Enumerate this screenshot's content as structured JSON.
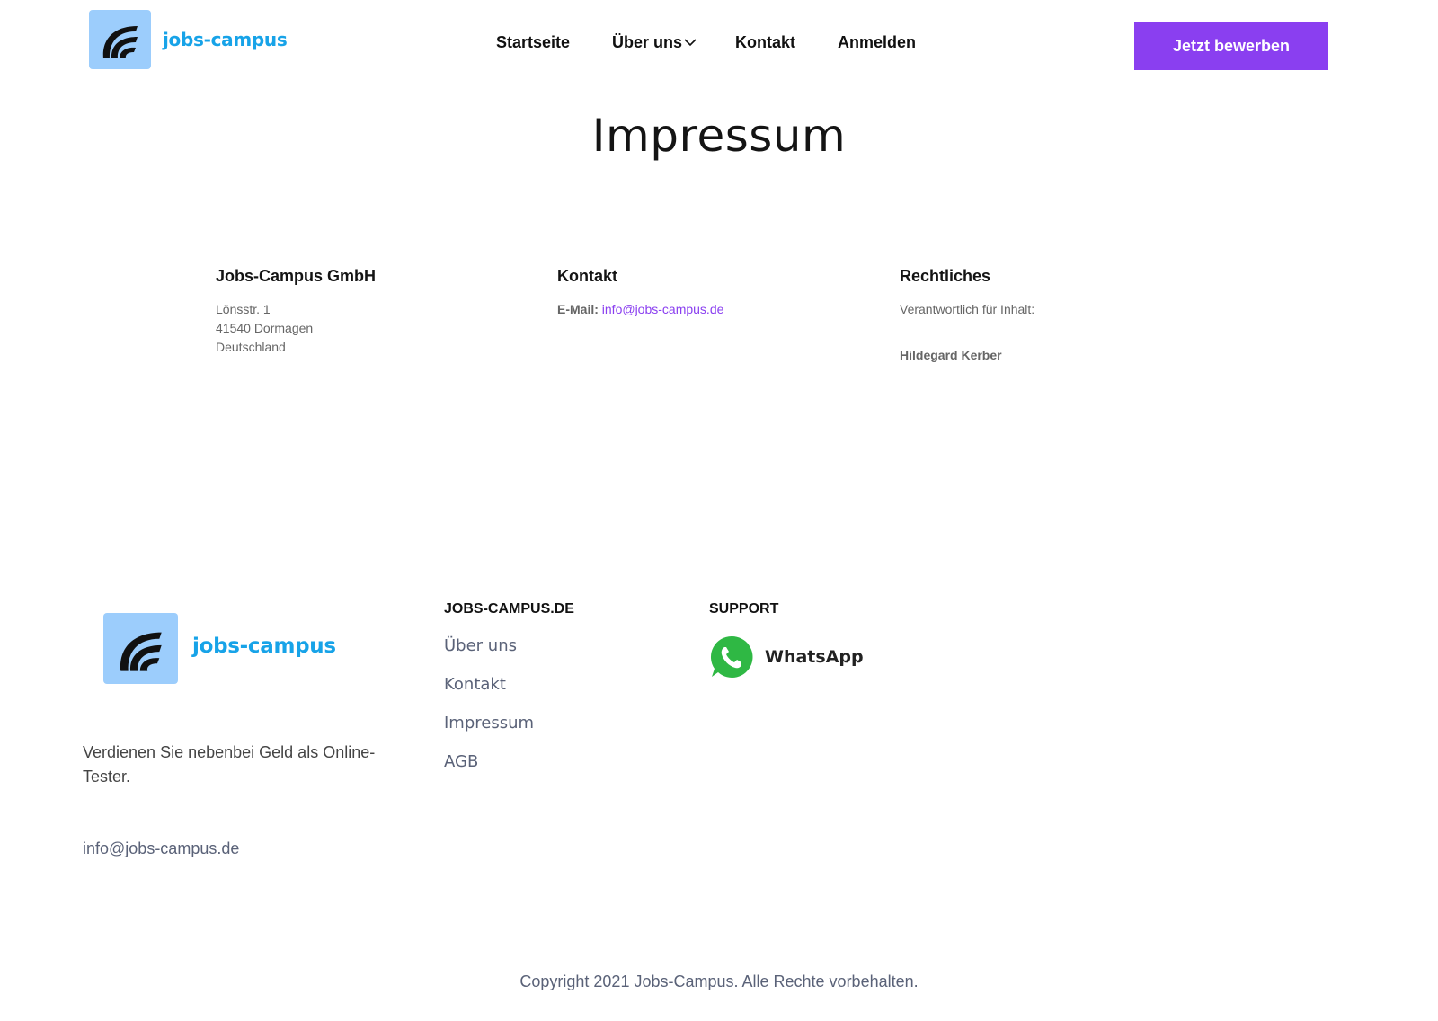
{
  "brand": {
    "name": "jobs-campus",
    "icon": "jobs-campus-logo-icon",
    "accent": "#17a3e8",
    "logo_bg": "#9ccdfc"
  },
  "nav": {
    "items": [
      {
        "label": "Startseite"
      },
      {
        "label": "Über uns",
        "has_dropdown": true,
        "icon": "chevron-down-icon"
      },
      {
        "label": "Kontakt"
      },
      {
        "label": "Anmelden"
      }
    ],
    "cta_label": "Jetzt bewerben",
    "cta_color": "#8a3ff0"
  },
  "page": {
    "title": "Impressum"
  },
  "impressum": {
    "company": {
      "heading": "Jobs-Campus GmbH",
      "street": "Lönsstr. 1",
      "city": "41540 Dormagen",
      "country": "Deutschland"
    },
    "contact": {
      "heading": "Kontakt",
      "email_label": "E-Mail:",
      "email": "info@jobs-campus.de"
    },
    "legal": {
      "heading": "Rechtliches",
      "responsible_label": "Verantwortlich für Inhalt:",
      "responsible_name": "Hildegard Kerber"
    }
  },
  "footer": {
    "tagline": "Verdienen Sie nebenbei Geld als Online-Tester.",
    "email": "info@jobs-campus.de",
    "links_heading": "JOBS-CAMPUS.DE",
    "links": [
      "Über uns",
      "Kontakt",
      "Impressum",
      "AGB"
    ],
    "support_heading": "SUPPORT",
    "whatsapp_label": "WhatsApp",
    "whatsapp_icon": "whatsapp-icon",
    "whatsapp_color": "#2fb844",
    "copyright": "Copyright 2021 Jobs-Campus. Alle Rechte vorbehalten."
  }
}
